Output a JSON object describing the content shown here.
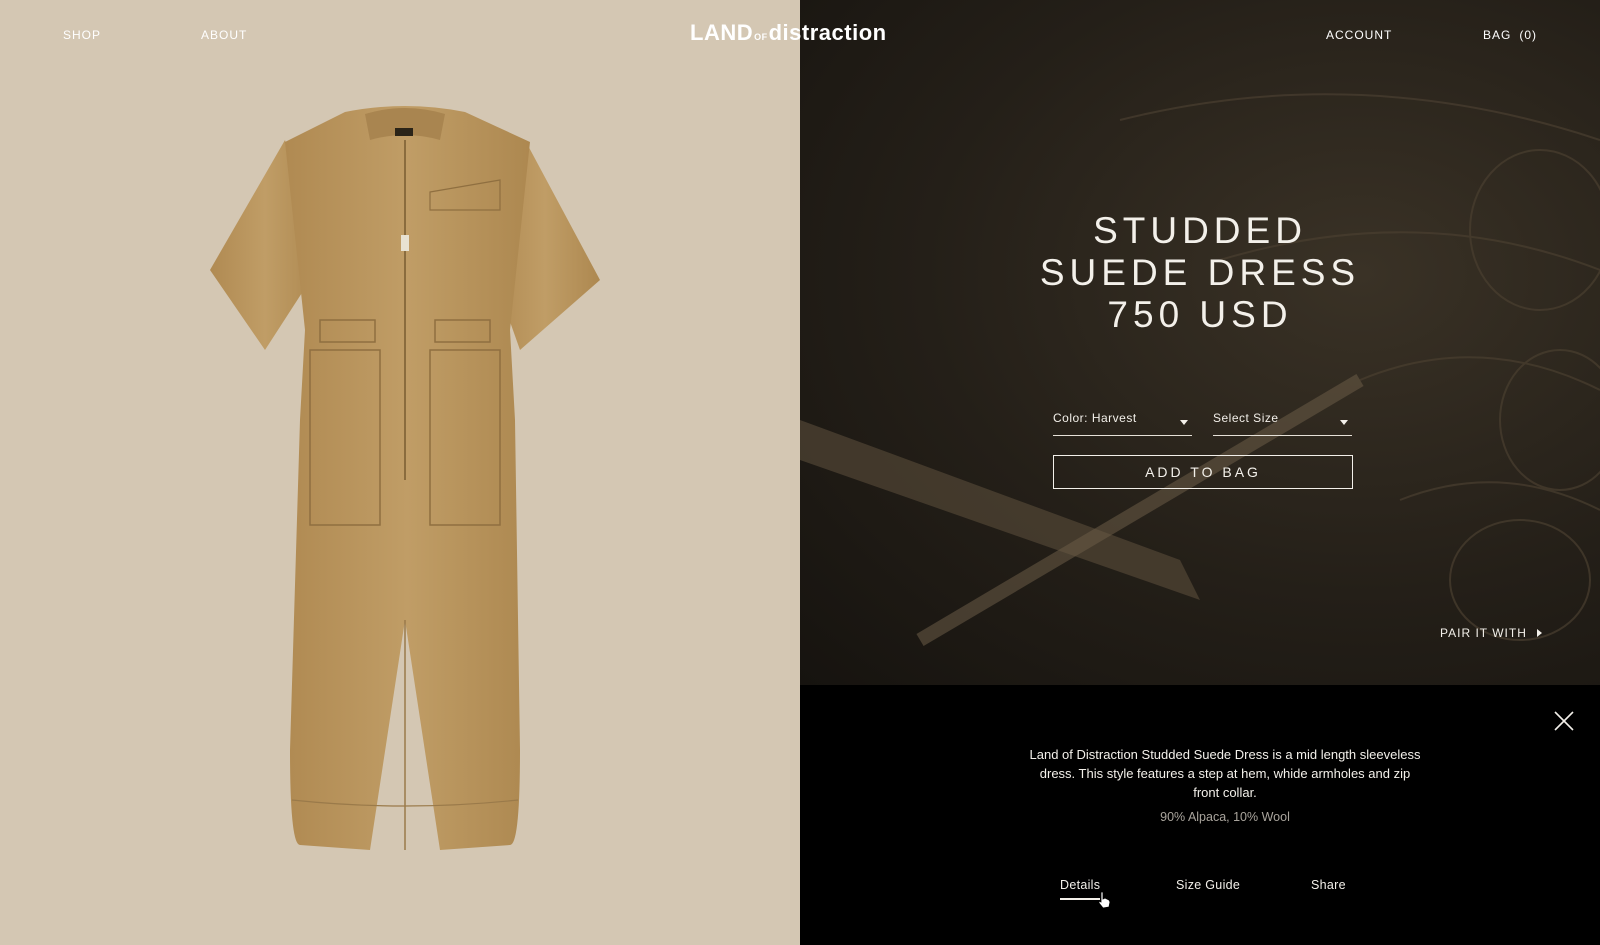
{
  "header": {
    "nav_shop": "SHOP",
    "nav_about": "ABOUT",
    "logo_land": "LAND",
    "logo_of": "OF",
    "logo_distraction": "distraction",
    "account": "ACCOUNT",
    "bag_label": "BAG",
    "bag_count": "(0)"
  },
  "product": {
    "title_line1": "STUDDED",
    "title_line2": "SUEDE DRESS",
    "price": "750 USD",
    "color_select": "Color: Harvest",
    "size_select": "Select Size",
    "add_to_bag": "ADD TO BAG",
    "pair_with": "PAIR IT WITH"
  },
  "details": {
    "description": "Land of Distraction Studded Suede Dress is a mid length sleeveless dress. This style features a step at hem, whide armholes and zip front collar.",
    "composition": "90% Alpaca, 10% Wool",
    "tabs": [
      "Details",
      "Size Guide",
      "Share"
    ],
    "active_tab": "Details"
  },
  "colors": {
    "left_bg": "#d4c7b3",
    "garment": "#b9975f",
    "hero_dark": "#241f18",
    "panel_black": "#000000"
  },
  "icons": [
    "dropdown-caret-icon",
    "arrow-right-icon",
    "close-icon",
    "hand-pointer-cursor"
  ]
}
